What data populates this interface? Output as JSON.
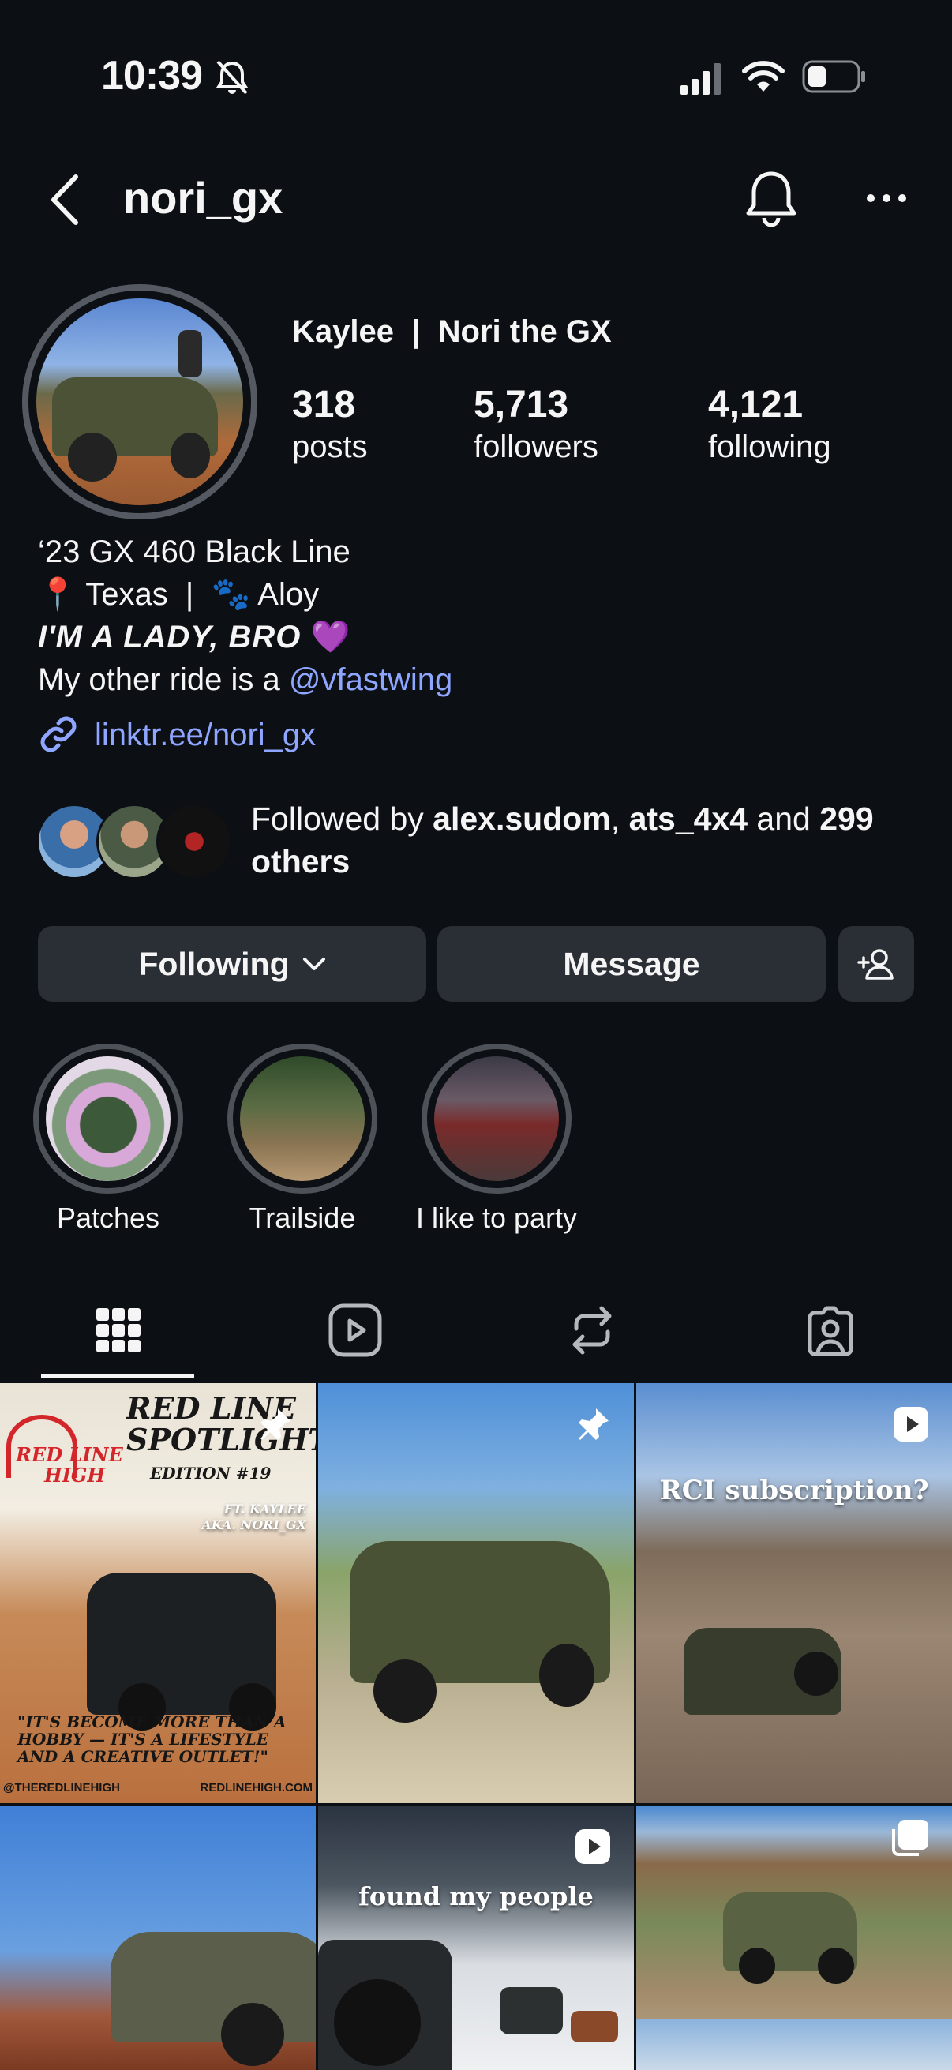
{
  "status_bar": {
    "time": "10:39"
  },
  "header": {
    "username": "nori_gx"
  },
  "profile": {
    "display_name": "Kaylee  |  Nori the GX",
    "stats": [
      {
        "value": "318",
        "label": "posts"
      },
      {
        "value": "5,713",
        "label": "followers"
      },
      {
        "value": "4,121",
        "label": "following"
      }
    ],
    "bio": {
      "line1": "‘23 GX 460 Black Line",
      "line2_pin": "📍",
      "line2_text": " Texas  |  ",
      "line2_paw": "🐾",
      "line2_pet": " Aloy",
      "line3": "I'M A LADY, BRO",
      "line3_emoji": " 💜",
      "line4_prefix": "My other ride is a ",
      "line4_mention": "@vfastwing"
    },
    "link": "linktr.ee/nori_gx"
  },
  "followed_by": {
    "prefix": "Followed by ",
    "user1": "alex.sudom",
    "sep": ", ",
    "user2": "ats_4x4",
    "and": " and ",
    "others": "299 others"
  },
  "buttons": {
    "following": "Following",
    "message": "Message"
  },
  "highlights": [
    {
      "label": "Patches"
    },
    {
      "label": "Trailside"
    },
    {
      "label": "I like to party"
    }
  ],
  "tabs": [
    "grid",
    "reels",
    "reposts",
    "tagged"
  ],
  "posts": {
    "p1": {
      "title1": "RED LINE",
      "title2": "SPOTLIGHT!",
      "edition": "EDITION #19",
      "ft1": "FT. KAYLEE",
      "ft2": "AKA. NORI_GX",
      "logo1": "RED LINE",
      "logo2": "HIGH",
      "quote1": "\"IT'S BECOME MORE THAN A",
      "quote2": "HOBBY — IT'S A LIFESTYLE",
      "quote3": "AND A CREATIVE OUTLET!\"",
      "handle": "@THEREDLINEHIGH",
      "site": "REDLINEHIGH.COM"
    },
    "p3": {
      "caption": "RCI subscription?"
    },
    "p5": {
      "caption": "found my people"
    }
  },
  "colors": {
    "background": "#0c0f14",
    "button": "#2a2e35",
    "link": "#8ea6ff"
  }
}
